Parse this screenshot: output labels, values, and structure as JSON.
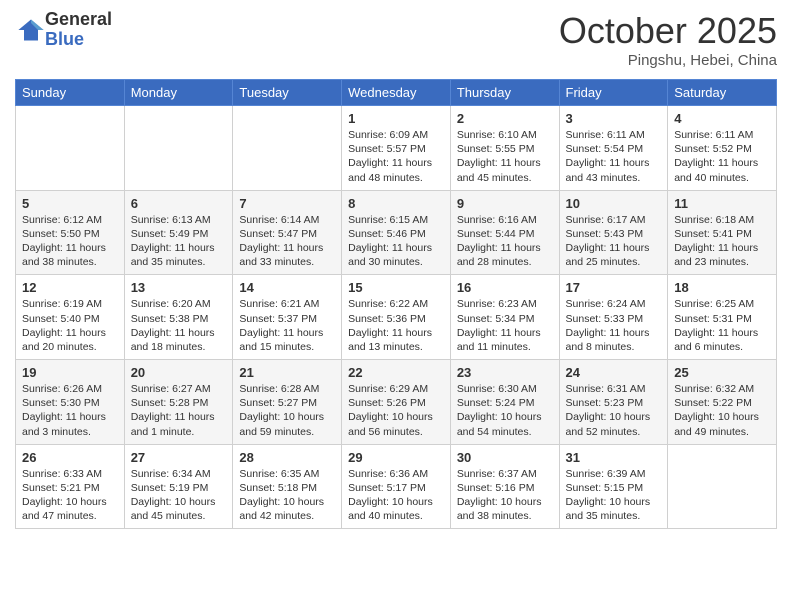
{
  "logo": {
    "general": "General",
    "blue": "Blue"
  },
  "header": {
    "month": "October 2025",
    "location": "Pingshu, Hebei, China"
  },
  "weekdays": [
    "Sunday",
    "Monday",
    "Tuesday",
    "Wednesday",
    "Thursday",
    "Friday",
    "Saturday"
  ],
  "weeks": [
    [
      {
        "day": "",
        "info": ""
      },
      {
        "day": "",
        "info": ""
      },
      {
        "day": "",
        "info": ""
      },
      {
        "day": "1",
        "info": "Sunrise: 6:09 AM\nSunset: 5:57 PM\nDaylight: 11 hours and 48 minutes."
      },
      {
        "day": "2",
        "info": "Sunrise: 6:10 AM\nSunset: 5:55 PM\nDaylight: 11 hours and 45 minutes."
      },
      {
        "day": "3",
        "info": "Sunrise: 6:11 AM\nSunset: 5:54 PM\nDaylight: 11 hours and 43 minutes."
      },
      {
        "day": "4",
        "info": "Sunrise: 6:11 AM\nSunset: 5:52 PM\nDaylight: 11 hours and 40 minutes."
      }
    ],
    [
      {
        "day": "5",
        "info": "Sunrise: 6:12 AM\nSunset: 5:50 PM\nDaylight: 11 hours and 38 minutes."
      },
      {
        "day": "6",
        "info": "Sunrise: 6:13 AM\nSunset: 5:49 PM\nDaylight: 11 hours and 35 minutes."
      },
      {
        "day": "7",
        "info": "Sunrise: 6:14 AM\nSunset: 5:47 PM\nDaylight: 11 hours and 33 minutes."
      },
      {
        "day": "8",
        "info": "Sunrise: 6:15 AM\nSunset: 5:46 PM\nDaylight: 11 hours and 30 minutes."
      },
      {
        "day": "9",
        "info": "Sunrise: 6:16 AM\nSunset: 5:44 PM\nDaylight: 11 hours and 28 minutes."
      },
      {
        "day": "10",
        "info": "Sunrise: 6:17 AM\nSunset: 5:43 PM\nDaylight: 11 hours and 25 minutes."
      },
      {
        "day": "11",
        "info": "Sunrise: 6:18 AM\nSunset: 5:41 PM\nDaylight: 11 hours and 23 minutes."
      }
    ],
    [
      {
        "day": "12",
        "info": "Sunrise: 6:19 AM\nSunset: 5:40 PM\nDaylight: 11 hours and 20 minutes."
      },
      {
        "day": "13",
        "info": "Sunrise: 6:20 AM\nSunset: 5:38 PM\nDaylight: 11 hours and 18 minutes."
      },
      {
        "day": "14",
        "info": "Sunrise: 6:21 AM\nSunset: 5:37 PM\nDaylight: 11 hours and 15 minutes."
      },
      {
        "day": "15",
        "info": "Sunrise: 6:22 AM\nSunset: 5:36 PM\nDaylight: 11 hours and 13 minutes."
      },
      {
        "day": "16",
        "info": "Sunrise: 6:23 AM\nSunset: 5:34 PM\nDaylight: 11 hours and 11 minutes."
      },
      {
        "day": "17",
        "info": "Sunrise: 6:24 AM\nSunset: 5:33 PM\nDaylight: 11 hours and 8 minutes."
      },
      {
        "day": "18",
        "info": "Sunrise: 6:25 AM\nSunset: 5:31 PM\nDaylight: 11 hours and 6 minutes."
      }
    ],
    [
      {
        "day": "19",
        "info": "Sunrise: 6:26 AM\nSunset: 5:30 PM\nDaylight: 11 hours and 3 minutes."
      },
      {
        "day": "20",
        "info": "Sunrise: 6:27 AM\nSunset: 5:28 PM\nDaylight: 11 hours and 1 minute."
      },
      {
        "day": "21",
        "info": "Sunrise: 6:28 AM\nSunset: 5:27 PM\nDaylight: 10 hours and 59 minutes."
      },
      {
        "day": "22",
        "info": "Sunrise: 6:29 AM\nSunset: 5:26 PM\nDaylight: 10 hours and 56 minutes."
      },
      {
        "day": "23",
        "info": "Sunrise: 6:30 AM\nSunset: 5:24 PM\nDaylight: 10 hours and 54 minutes."
      },
      {
        "day": "24",
        "info": "Sunrise: 6:31 AM\nSunset: 5:23 PM\nDaylight: 10 hours and 52 minutes."
      },
      {
        "day": "25",
        "info": "Sunrise: 6:32 AM\nSunset: 5:22 PM\nDaylight: 10 hours and 49 minutes."
      }
    ],
    [
      {
        "day": "26",
        "info": "Sunrise: 6:33 AM\nSunset: 5:21 PM\nDaylight: 10 hours and 47 minutes."
      },
      {
        "day": "27",
        "info": "Sunrise: 6:34 AM\nSunset: 5:19 PM\nDaylight: 10 hours and 45 minutes."
      },
      {
        "day": "28",
        "info": "Sunrise: 6:35 AM\nSunset: 5:18 PM\nDaylight: 10 hours and 42 minutes."
      },
      {
        "day": "29",
        "info": "Sunrise: 6:36 AM\nSunset: 5:17 PM\nDaylight: 10 hours and 40 minutes."
      },
      {
        "day": "30",
        "info": "Sunrise: 6:37 AM\nSunset: 5:16 PM\nDaylight: 10 hours and 38 minutes."
      },
      {
        "day": "31",
        "info": "Sunrise: 6:39 AM\nSunset: 5:15 PM\nDaylight: 10 hours and 35 minutes."
      },
      {
        "day": "",
        "info": ""
      }
    ]
  ]
}
